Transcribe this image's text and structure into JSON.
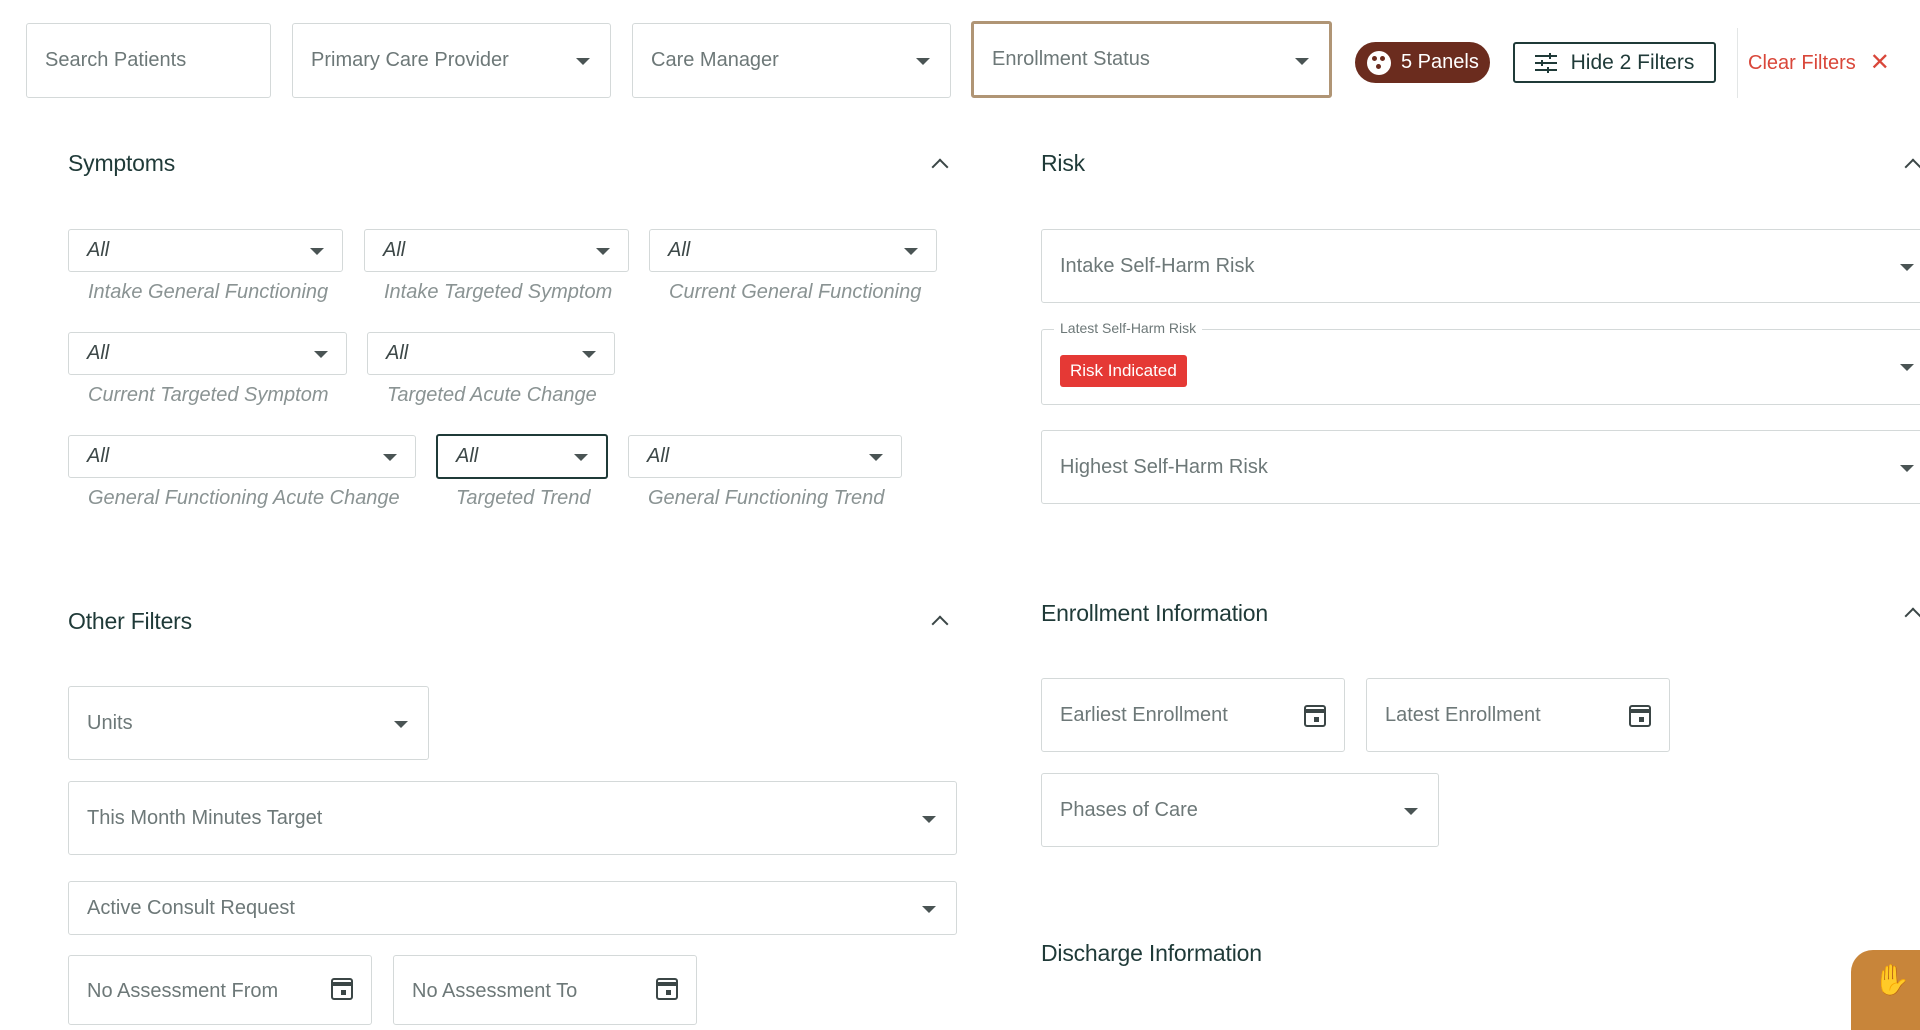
{
  "top_bar": {
    "search_placeholder": "Search Patients",
    "primary_care_provider": "Primary Care Provider",
    "care_manager": "Care Manager",
    "enrollment_status": "Enrollment Status",
    "panels_label": "5 Panels",
    "hide_filters_label": "Hide 2 Filters",
    "clear_filters_label": "Clear Filters"
  },
  "symptoms": {
    "title": "Symptoms",
    "filters": [
      {
        "value": "All",
        "label": "Intake General Functioning"
      },
      {
        "value": "All",
        "label": "Intake Targeted Symptom"
      },
      {
        "value": "All",
        "label": "Current General Functioning"
      },
      {
        "value": "All",
        "label": "Current Targeted Symptom"
      },
      {
        "value": "All",
        "label": "Targeted Acute Change"
      },
      {
        "value": "All",
        "label": "General Functioning Acute Change"
      },
      {
        "value": "All",
        "label": "Targeted Trend"
      },
      {
        "value": "All",
        "label": "General Functioning Trend"
      }
    ]
  },
  "risk": {
    "title": "Risk",
    "intake_self_harm": "Intake Self-Harm Risk",
    "latest_self_harm_legend": "Latest Self-Harm Risk",
    "latest_self_harm_chip": "Risk Indicated",
    "highest_self_harm": "Highest Self-Harm Risk"
  },
  "other_filters": {
    "title": "Other Filters",
    "units": "Units",
    "month_minutes_target": "This Month Minutes Target",
    "active_consult_request": "Active Consult Request",
    "no_assessment_from": "No Assessment From",
    "no_assessment_to": "No Assessment To"
  },
  "enrollment": {
    "title": "Enrollment Information",
    "earliest": "Earliest Enrollment",
    "latest": "Latest Enrollment",
    "phases_of_care": "Phases of Care"
  },
  "discharge": {
    "title": "Discharge Information"
  },
  "colors": {
    "accent_brown": "#6b2c1e",
    "focus_tan": "#b09575",
    "danger_red": "#e53935",
    "clear_red": "#d9473a",
    "text_dark": "#1f3a38"
  }
}
